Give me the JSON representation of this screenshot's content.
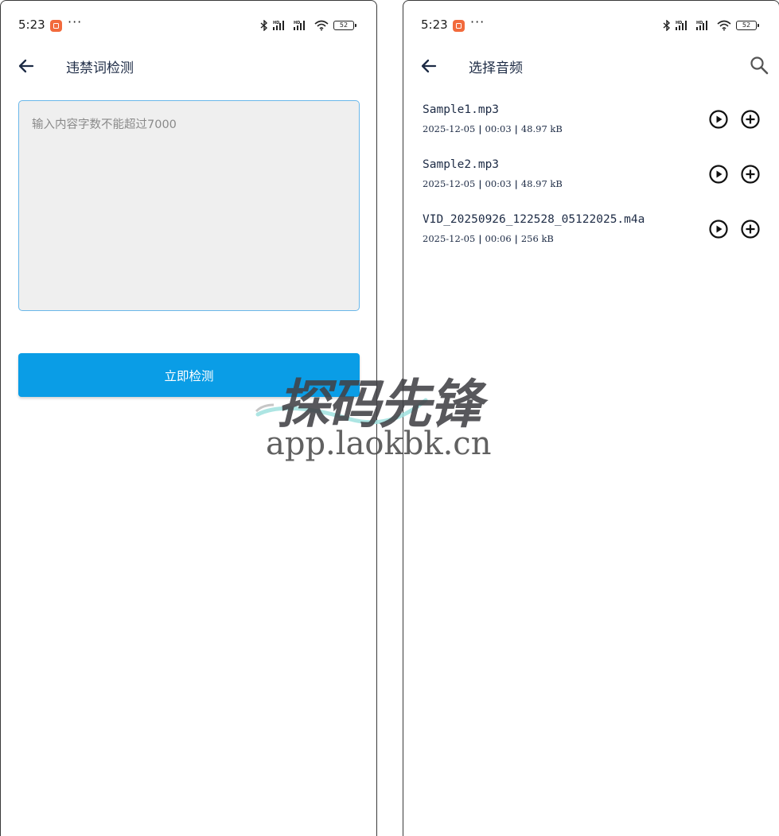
{
  "status_bar": {
    "time": "5:23",
    "battery": "52",
    "icons": [
      "notification-icon",
      "more-dots-icon",
      "bluetooth-icon",
      "hd-signal-icon",
      "hd-signal-icon",
      "wifi-icon",
      "battery-icon"
    ]
  },
  "left_screen": {
    "title": "违禁词检测",
    "input": {
      "value": "",
      "placeholder": "输入内容字数不能超过7000"
    },
    "button_label": "立即检测",
    "accent_color": "#0a9de6"
  },
  "right_screen": {
    "title": "选择音频",
    "files": [
      {
        "name": "Sample1.mp3",
        "date": "2025-12-05",
        "duration": "00:03",
        "size": "48.97 kB"
      },
      {
        "name": "Sample2.mp3",
        "date": "2025-12-05",
        "duration": "00:03",
        "size": "48.97 kB"
      },
      {
        "name": "VID_20250926_122528_05122025.m4a",
        "date": "2025-12-05",
        "duration": "00:06",
        "size": "256 kB"
      }
    ]
  },
  "watermark": {
    "logo_text": "探码先锋",
    "url": "app.laokbk.cn"
  }
}
